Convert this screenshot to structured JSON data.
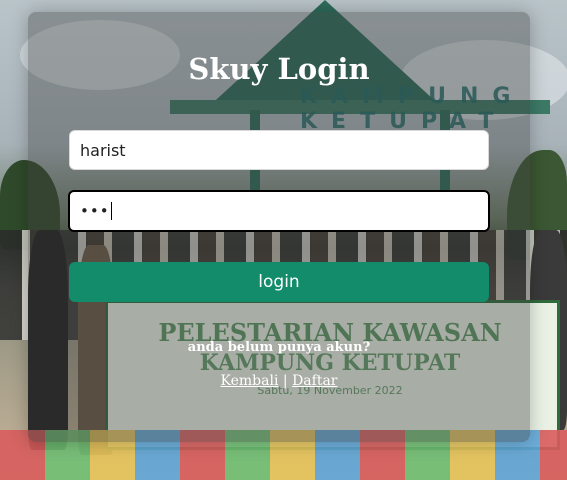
{
  "login": {
    "title": "Skuy Login",
    "username_value": "harist",
    "password_mask": "•••",
    "button_label": "login",
    "prompt_text": "anda belum punya akun?",
    "back_link": "Kembali",
    "separator": "|",
    "register_link": "Daftar"
  },
  "background": {
    "gate_sign": "KAMPUNG KETUPAT",
    "banner_title": "PELESTARIAN KAWASAN",
    "banner_subtitle": "KAMPUNG KETUPAT",
    "banner_date": "Sabtu, 19 November 2022"
  },
  "colors": {
    "button": "#128c6b",
    "panel_overlay": "rgba(60,60,60,0.38)",
    "text": "#ffffff"
  }
}
